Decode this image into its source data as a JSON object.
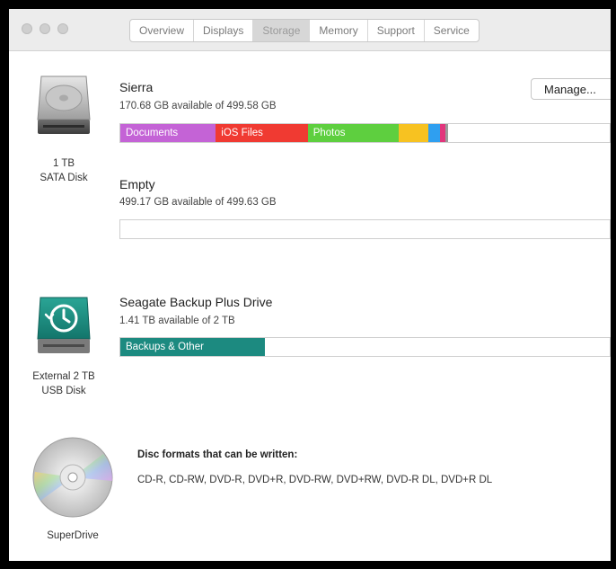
{
  "window": {
    "tabs": [
      {
        "label": "Overview",
        "active": false
      },
      {
        "label": "Displays",
        "active": false
      },
      {
        "label": "Storage",
        "active": true
      },
      {
        "label": "Memory",
        "active": false
      },
      {
        "label": "Support",
        "active": false
      },
      {
        "label": "Service",
        "active": false
      }
    ]
  },
  "devices": [
    {
      "caption_line1": "1 TB",
      "caption_line2": "SATA Disk",
      "icon": "hard-disk-icon"
    },
    {
      "caption_line1": "External 2 TB",
      "caption_line2": "USB Disk",
      "icon": "time-machine-disk-icon"
    },
    {
      "caption_line1": "SuperDrive",
      "icon": "optical-disc-icon"
    }
  ],
  "volumes": [
    {
      "name": "Sierra",
      "available": "170.68 GB available of 499.58 GB",
      "manage_label": "Manage...",
      "segments": [
        {
          "label": "Documents",
          "color": "#c463d6",
          "fraction": 0.195
        },
        {
          "label": "iOS Files",
          "color": "#f03a32",
          "fraction": 0.188
        },
        {
          "label": "Photos",
          "color": "#5ecf3f",
          "fraction": 0.186
        },
        {
          "label": "",
          "color": "#f7c221",
          "fraction": 0.06
        },
        {
          "label": "",
          "color": "#2f9ff0",
          "fraction": 0.025
        },
        {
          "label": "",
          "color": "#e2357c",
          "fraction": 0.01
        },
        {
          "label": "",
          "color": "#9b9b9b",
          "fraction": 0.006
        }
      ]
    },
    {
      "name": "Empty",
      "available": "499.17 GB available of 499.63 GB",
      "segments": []
    },
    {
      "name": "Seagate Backup Plus Drive",
      "available": "1.41 TB available of 2 TB",
      "segments": [
        {
          "label": "Backups & Other",
          "color": "#1c8a80",
          "fraction": 0.295
        }
      ]
    }
  ],
  "superdrive": {
    "formats_title": "Disc formats that can be written:",
    "formats": "CD-R, CD-RW, DVD-R, DVD+R, DVD-RW, DVD+RW, DVD-R DL, DVD+R DL"
  }
}
